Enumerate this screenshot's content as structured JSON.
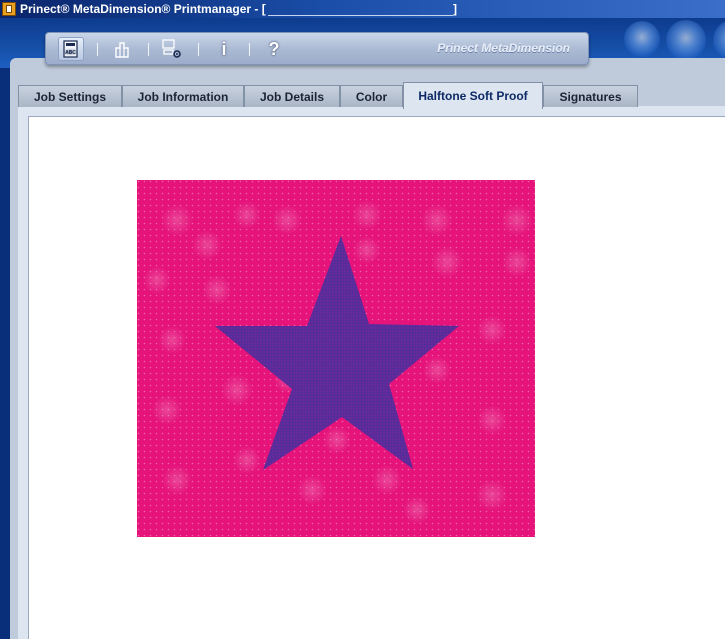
{
  "window": {
    "title_prefix": "Prinect® MetaDimension® Printmanager - [",
    "title_suffix": "]"
  },
  "toolbar": {
    "buttons": [
      {
        "icon": "job-document-icon",
        "glyph": ""
      },
      {
        "icon": "columns-icon",
        "glyph": ""
      },
      {
        "icon": "computer-settings-icon",
        "glyph": ""
      },
      {
        "icon": "info-icon",
        "glyph": "i"
      },
      {
        "icon": "help-icon",
        "glyph": "?"
      }
    ],
    "brand": "Prinect MetaDimension"
  },
  "tabs": [
    {
      "label": "Job Settings",
      "selected": false
    },
    {
      "label": "Job Information",
      "selected": false
    },
    {
      "label": "Job Details",
      "selected": false
    },
    {
      "label": "Color",
      "selected": false
    },
    {
      "label": "Halftone Soft Proof",
      "selected": true
    },
    {
      "label": "Signatures",
      "selected": false
    }
  ],
  "proof": {
    "background_color": "#e5137a",
    "star_color": "#5a2a9a",
    "dot_color": "#f4a6cf"
  }
}
